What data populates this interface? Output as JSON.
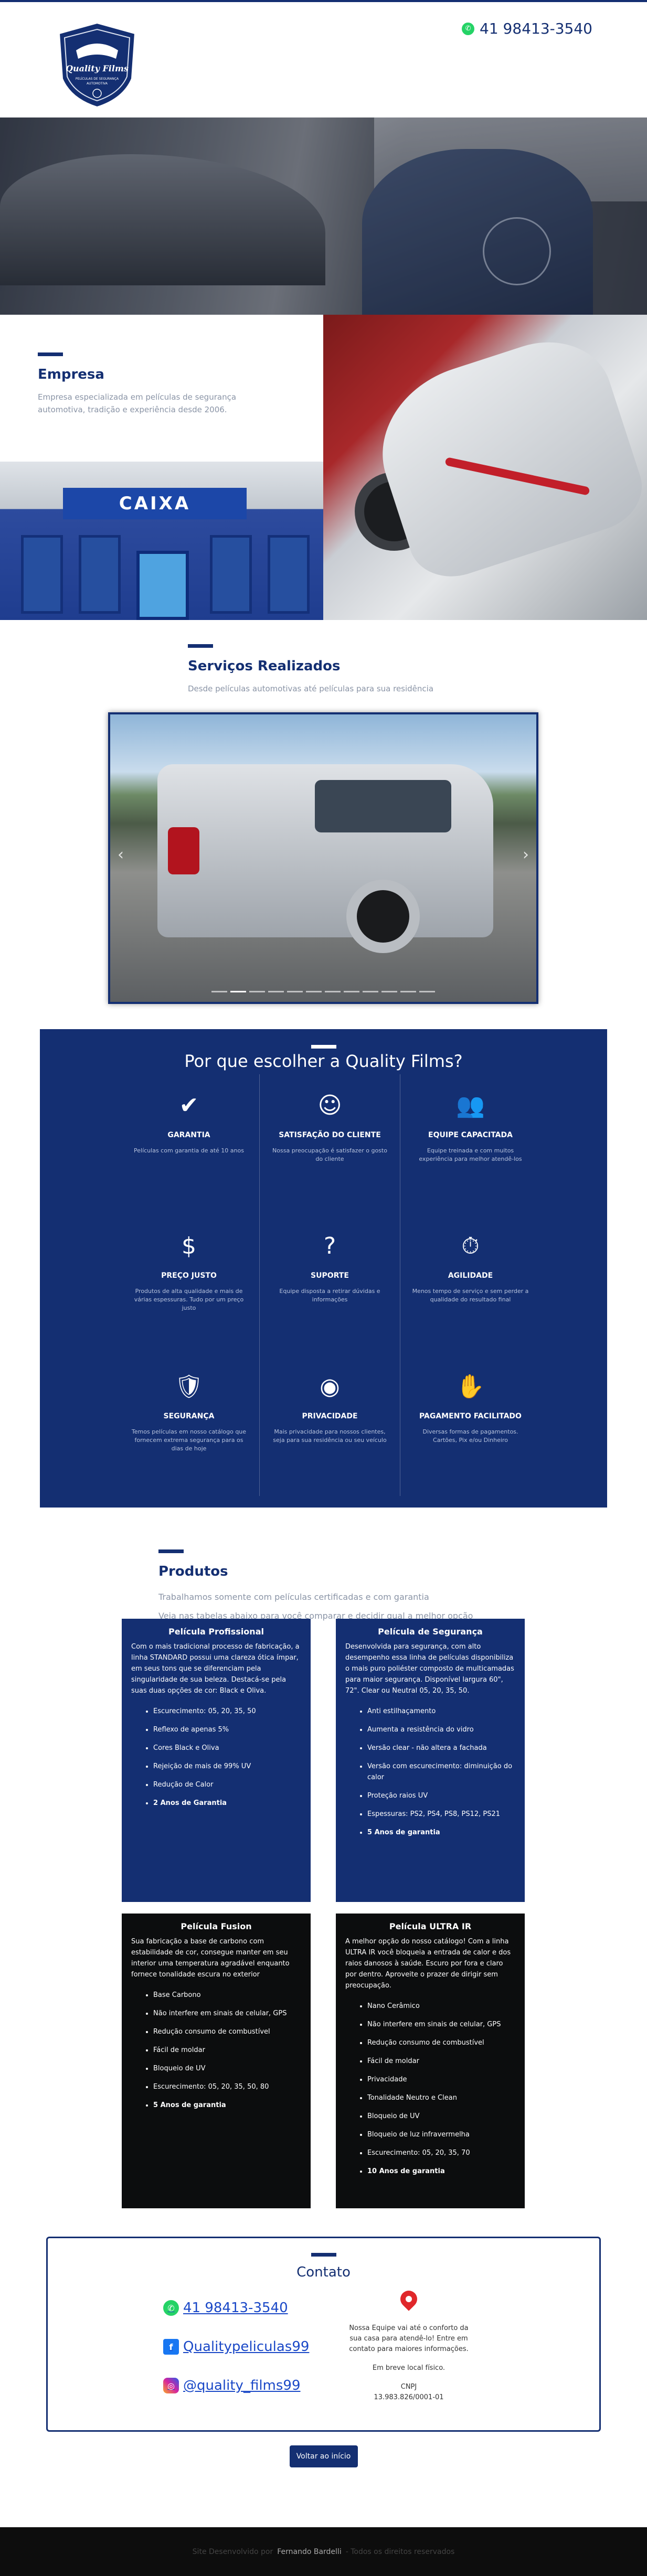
{
  "header": {
    "logo_text": "Quality Films",
    "logo_subtext": "PELÍCULAS DE SEGURANÇA AUTOMOTIVA",
    "phone": "41 98413-3540"
  },
  "empresa": {
    "title": "Empresa",
    "description": "Empresa especializada em películas de segurança automotiva, tradição e experiência desde 2006.",
    "bank_sign": "CAIXA"
  },
  "servicos": {
    "title": "Serviços Realizados",
    "subtitle": "Desde películas automotivas até películas para sua residência",
    "slides": 12,
    "active_slide": 1
  },
  "porque": {
    "title": "Por que escolher a Quality Films?",
    "items": [
      {
        "icon": "badge-check-icon",
        "title": "GARANTIA",
        "text": "Películas com garantia de até 10 anos"
      },
      {
        "icon": "customer-satisfaction-icon",
        "title": "SATISFAÇÃO DO CLIENTE",
        "text": "Nossa preocupação é satisfazer o gosto do cliente"
      },
      {
        "icon": "team-icon",
        "title": "EQUIPE CAPACITADA",
        "text": "Equipe treinada e com muitos experiência para melhor atendê-los"
      },
      {
        "icon": "price-tag-icon",
        "title": "PREÇO JUSTO",
        "text": "Produtos de alta qualidade e mais de várias espessuras. Tudo por um preço justo"
      },
      {
        "icon": "support-icon",
        "title": "SUPORTE",
        "text": "Equipe disposta a retirar dúvidas e informações"
      },
      {
        "icon": "clock-icon",
        "title": "AGILIDADE",
        "text": "Menos tempo de serviço e sem perder a qualidade do resultado final"
      },
      {
        "icon": "shield-lock-icon",
        "title": "SEGURANÇA",
        "text": "Temos películas em nosso catálogo que fornecem extrema segurança para os dias de hoje"
      },
      {
        "icon": "eye-slash-icon",
        "title": "PRIVACIDADE",
        "text": "Mais privacidade para nossos clientes, seja para sua residência ou seu veículo"
      },
      {
        "icon": "payment-icon",
        "title": "PAGAMENTO FACILITADO",
        "text": "Diversas formas de pagamentos. Cartões, Pix e/ou Dinheiro"
      }
    ]
  },
  "produtos": {
    "title": "Produtos",
    "subtitle1": "Trabalhamos somente com películas certificadas e com garantia",
    "subtitle2": "Veja nas tabelas abaixo para você comparar e decidir qual a melhor opção",
    "cards": [
      {
        "title": "Película Profissional",
        "intro": "Com o mais tradicional processo de fabricação, a linha STANDARD possui uma clareza ótica ímpar, em seus tons que se diferenciam pela singularidade de sua beleza. Destacá-se pela suas duas opções de cor: Black e Oliva.",
        "items": [
          "Escurecimento: 05, 20, 35, 50",
          "Reflexo de apenas 5%",
          "Cores Black e Oliva",
          "Rejeição de mais de 99% UV",
          "Redução de Calor"
        ],
        "bold_item": "2 Anos de Garantia"
      },
      {
        "title": "Película de Segurança",
        "intro": "Desenvolvida para segurança, com alto desempenho essa linha de películas disponibiliza o mais puro poliéster composto de multicamadas para maior segurança. Disponível largura 60\", 72\". Clear ou Neutral 05, 20, 35, 50.",
        "items": [
          "Anti estilhaçamento",
          "Aumenta a resistência do vidro",
          "Versão clear - não altera a fachada",
          "Versão com escurecimento: diminuição do calor",
          "Proteção raios UV",
          "Espessuras: PS2, PS4, PS8, PS12, PS21"
        ],
        "bold_item": "5 Anos de garantia"
      },
      {
        "title": "Película Fusion",
        "intro": "Sua fabricação a base de carbono com estabilidade de cor, consegue manter em seu interior uma temperatura agradável enquanto fornece tonalidade escura no exterior",
        "items": [
          "Base Carbono",
          "Não interfere em sinais de celular, GPS",
          "Redução consumo de combustível",
          "Fácil de moldar",
          "Bloqueio de UV",
          "Escurecimento: 05, 20, 35, 50, 80"
        ],
        "bold_item": "5 Anos de garantia"
      },
      {
        "title": "Película ULTRA IR",
        "intro": "A melhor opção do nosso catálogo! Com a linha ULTRA IR você bloqueia a entrada de calor e dos raios danosos à saúde. Escuro por fora e claro por dentro. Aproveite o prazer de dirigir sem preocupação.",
        "items": [
          "Nano Cerâmico",
          "Não interfere em sinais de celular, GPS",
          "Redução consumo de combustível",
          "Fácil de moldar",
          "Privacidade",
          "Tonalidade Neutro e Clean",
          "Bloqueio de UV",
          "Bloqueio de luz infravermelha",
          "Escurecimento: 05, 20, 35, 70"
        ],
        "bold_item": "10 Anos de garantia"
      }
    ]
  },
  "contato": {
    "title": "Contato",
    "whatsapp": "41 98413-3540",
    "facebook": "Qualitypeliculas99",
    "instagram": "@quality_films99",
    "message": "Nossa Equipe vai até o conforto da sua casa para atendê-lo! Entre em contato para maiores informações.",
    "coming": "Em breve local físico.",
    "cnpj_label": "CNPJ",
    "cnpj": "13.983.826/0001-01",
    "back_button": "Voltar ao início"
  },
  "footer": {
    "prefix": "Site Desenvolvido por",
    "name": "Fernando Bardelli",
    "suffix": "- Todos os direitos reservados"
  },
  "colors": {
    "brand": "#142f72",
    "whatsapp": "#25d366",
    "facebook": "#1877f2",
    "instagram": "#d6249f"
  }
}
